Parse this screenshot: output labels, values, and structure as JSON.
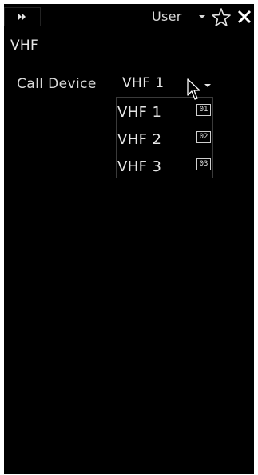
{
  "header": {
    "expand_icon": "fast-forward-icon",
    "user_label": "User",
    "star_icon": "star-icon",
    "close_icon": "close-icon"
  },
  "panel": {
    "title": "VHF"
  },
  "call_device": {
    "label": "Call Device",
    "selected_value": "VHF 1",
    "options": [
      {
        "label": "VHF 1",
        "key": "01"
      },
      {
        "label": "VHF 2",
        "key": "02"
      },
      {
        "label": "VHF 3",
        "key": "03"
      }
    ]
  },
  "colors": {
    "background": "#000000",
    "text": "#e6e6e6",
    "border": "#3a3a3a"
  }
}
